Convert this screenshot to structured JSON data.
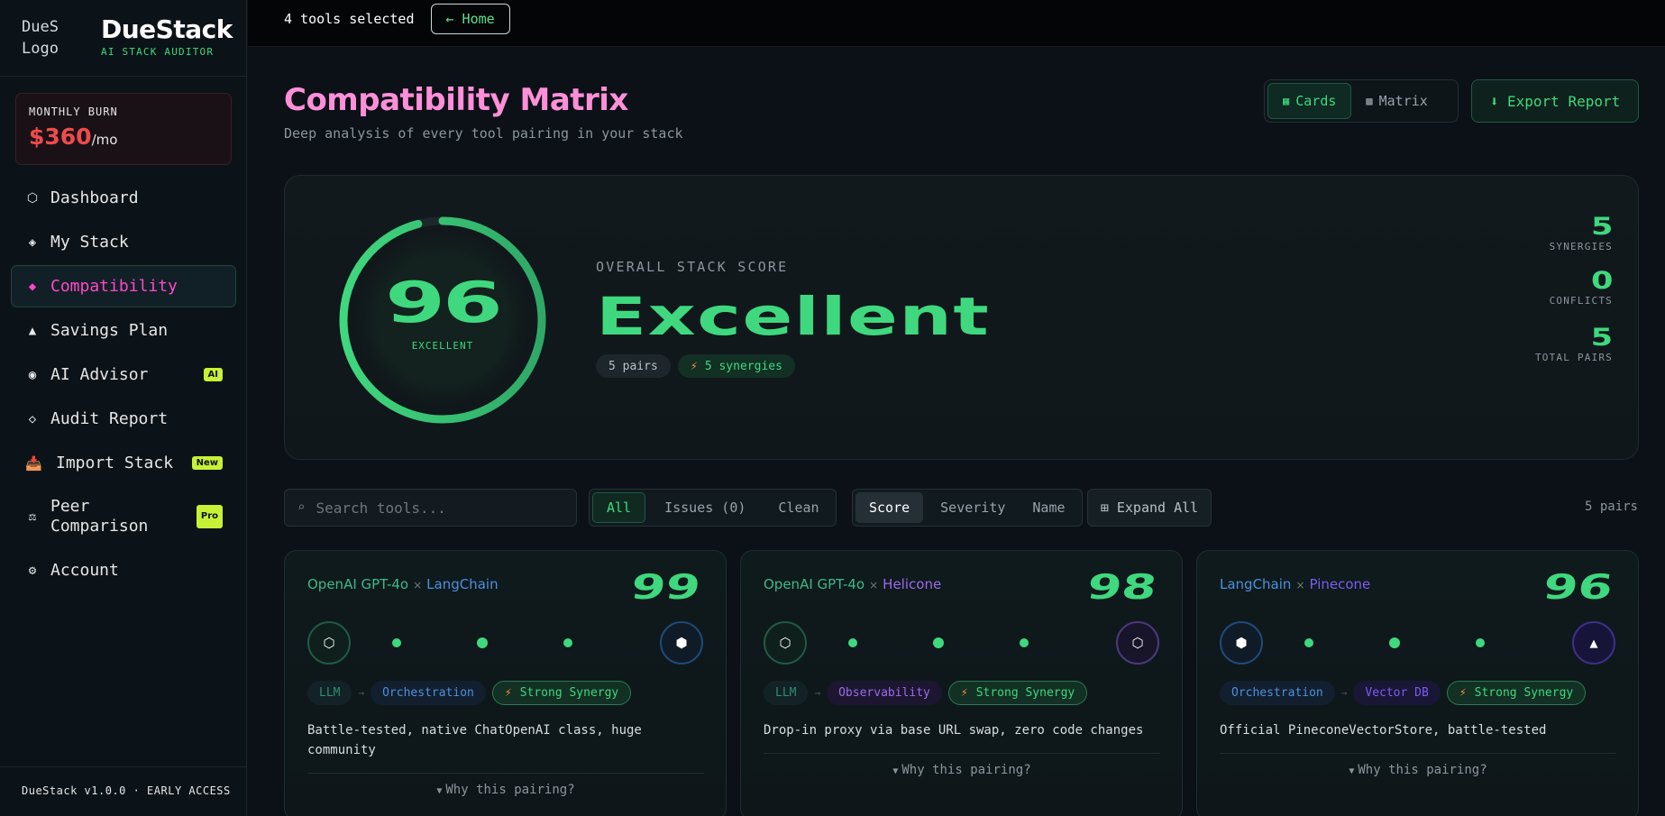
{
  "brand": {
    "logo_alt": "DueS Logo",
    "title": "DueStack",
    "subtitle": "AI STACK AUDITOR"
  },
  "burn": {
    "label": "MONTHLY BURN",
    "amount": "$360",
    "unit": "/mo"
  },
  "nav": [
    {
      "icon": "⬡",
      "label": "Dashboard",
      "badge": ""
    },
    {
      "icon": "◈",
      "label": "My Stack",
      "badge": ""
    },
    {
      "icon": "◆",
      "label": "Compatibility",
      "badge": ""
    },
    {
      "icon": "▲",
      "label": "Savings Plan",
      "badge": ""
    },
    {
      "icon": "◉",
      "label": "AI Advisor",
      "badge": "AI"
    },
    {
      "icon": "◇",
      "label": "Audit Report",
      "badge": ""
    },
    {
      "icon": "📥",
      "label": "Import Stack",
      "badge": "New"
    },
    {
      "icon": "⚖",
      "label": "Peer Comparison",
      "badge": "Pro"
    },
    {
      "icon": "⚙",
      "label": "Account",
      "badge": ""
    }
  ],
  "footer": "DueStack v1.0.0 · EARLY ACCESS",
  "topbar": {
    "count": "4 tools selected",
    "home": "← Home"
  },
  "header": {
    "title": "Compatibility Matrix",
    "subtitle": "Deep analysis of every tool pairing in your stack",
    "view_cards": "Cards",
    "view_matrix": "Matrix",
    "export": "⬇ Export Report"
  },
  "score": {
    "value": "96",
    "fraction": 0.96,
    "ring_label": "EXCELLENT",
    "overall_label": "OVERALL STACK SCORE",
    "overall_word": "Excellent",
    "pill_pairs": "5 pairs",
    "pill_synergies": "5 synergies",
    "stats": [
      {
        "value": "5",
        "label": "SYNERGIES"
      },
      {
        "value": "0",
        "label": "CONFLICTS"
      },
      {
        "value": "5",
        "label": "TOTAL PAIRS"
      }
    ]
  },
  "filters": {
    "search_placeholder": "Search tools...",
    "tabs": [
      "All",
      "Issues (0)",
      "Clean"
    ],
    "sort": [
      "Score",
      "Severity",
      "Name"
    ],
    "expand": "⊞ Expand All",
    "count": "5 pairs"
  },
  "cards": [
    {
      "tool_a": "OpenAI GPT-4o",
      "tool_b": "LangChain",
      "score": "99",
      "icon_a": "⬡",
      "icon_b": "⬢",
      "tag_a": "LLM",
      "tag_b": "Orchestration",
      "synergy": "Strong Synergy",
      "description": "Battle-tested, native ChatOpenAI class, huge community",
      "why": "Why this pairing?"
    },
    {
      "tool_a": "OpenAI GPT-4o",
      "tool_b": "Helicone",
      "score": "98",
      "icon_a": "⬡",
      "icon_b": "⬡",
      "tag_a": "LLM",
      "tag_b": "Observability",
      "synergy": "Strong Synergy",
      "description": "Drop-in proxy via base URL swap, zero code changes",
      "why": "Why this pairing?"
    },
    {
      "tool_a": "LangChain",
      "tool_b": "Pinecone",
      "score": "96",
      "icon_a": "⬢",
      "icon_b": "▲",
      "tag_a": "Orchestration",
      "tag_b": "Vector DB",
      "synergy": "Strong Synergy",
      "description": "Official PineconeVectorStore, battle-tested",
      "why": "Why this pairing?"
    }
  ],
  "colors": {
    "accent_green": "#3fd87e",
    "accent_pink": "#ff8fd8",
    "nav_active": "#ff47c8",
    "burn_red": "#ef4b4b",
    "llm": "#3fb88a",
    "orchestration": "#4f8fdc",
    "observability": "#9b6bea",
    "vector_db": "#7b5cf0"
  }
}
